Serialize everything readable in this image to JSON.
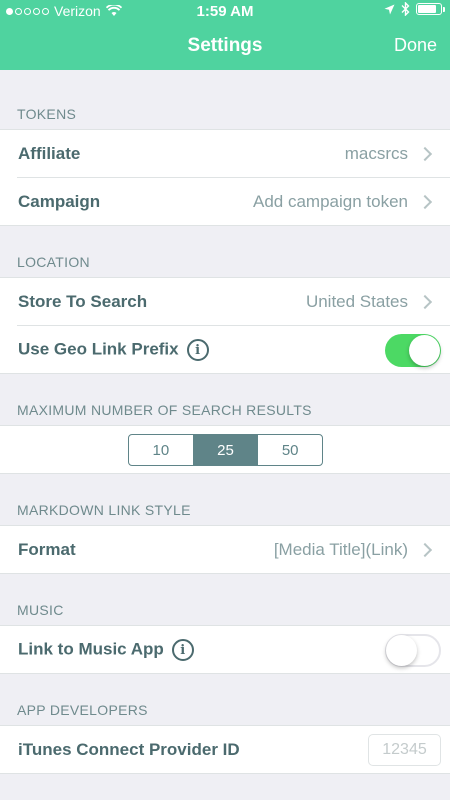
{
  "status_bar": {
    "carrier": "Verizon",
    "time": "1:59 AM",
    "signal_dots_filled": 1,
    "signal_dots_total": 5,
    "battery_level": 0.8
  },
  "nav": {
    "title": "Settings",
    "done_label": "Done"
  },
  "sections": {
    "tokens": {
      "header": "TOKENS",
      "affiliate_label": "Affiliate",
      "affiliate_value": "macsrcs",
      "campaign_label": "Campaign",
      "campaign_value": "Add campaign token"
    },
    "location": {
      "header": "LOCATION",
      "store_label": "Store To Search",
      "store_value": "United States",
      "geo_label": "Use Geo Link Prefix",
      "geo_enabled": true
    },
    "max_results": {
      "header": "MAXIMUM NUMBER OF SEARCH RESULTS",
      "options": [
        "10",
        "25",
        "50"
      ],
      "selected": "25"
    },
    "markdown": {
      "header": "MARKDOWN LINK STYLE",
      "format_label": "Format",
      "format_value": "[Media Title](Link)"
    },
    "music": {
      "header": "MUSIC",
      "link_label": "Link to Music App",
      "link_enabled": false
    },
    "app_developers": {
      "header": "APP DEVELOPERS",
      "provider_label": "iTunes Connect Provider ID",
      "provider_placeholder": "12345"
    }
  },
  "colors": {
    "nav_bar": "#4fd39f",
    "toggle_on": "#4cd964",
    "segment_accent": "#5f8488",
    "background": "#efeff4"
  },
  "icons": {
    "info": "info-circle-icon",
    "chevron": "chevron-right-icon",
    "wifi": "wifi-icon",
    "location": "location-arrow-icon",
    "bluetooth": "bluetooth-icon",
    "battery": "battery-icon"
  }
}
